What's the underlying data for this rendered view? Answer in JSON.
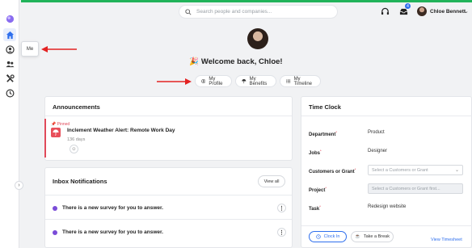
{
  "colors": {
    "accent": "#21b35a",
    "primary": "#2f6fed",
    "danger": "#e04a5a",
    "notification": "#7a4cd8"
  },
  "sidebar": {
    "items": [
      {
        "icon": "logo-icon"
      },
      {
        "icon": "home-icon"
      },
      {
        "icon": "person-icon"
      },
      {
        "icon": "people-icon"
      },
      {
        "icon": "tools-icon"
      },
      {
        "icon": "clock-icon"
      }
    ],
    "tooltip": "Me"
  },
  "header": {
    "search_placeholder": "Search people and companies...",
    "notification_count": "4",
    "user_name": "Chloe Bennett"
  },
  "welcome": {
    "emoji": "🎉",
    "text": "Welcome back, Chloe!"
  },
  "quick_links": [
    "My Profile",
    "My Benefits",
    "My Timeline"
  ],
  "announcements": {
    "title": "Announcements",
    "pinned_label": "Pinned",
    "item_title": "Inclement Weather Alert: Remote Work Day",
    "item_age": "136 days"
  },
  "inbox": {
    "title": "Inbox Notifications",
    "view_all": "View all",
    "items": [
      "There is a new survey for you to answer.",
      "There is a new survey for you to answer."
    ]
  },
  "time_clock": {
    "title": "Time Clock",
    "fields": {
      "department_label": "Department",
      "department_value": "Product",
      "jobs_label": "Jobs",
      "jobs_value": "Designer",
      "customers_label": "Customers or Grant",
      "customers_placeholder": "Select a Customers or Grant",
      "project_label": "Project",
      "project_placeholder": "Select a Customers or Grant first...",
      "task_label": "Task",
      "task_value": "Redesign website"
    },
    "clock_in": "Clock In",
    "take_break": "Take a Break",
    "view_timesheet": "View Timesheet"
  }
}
